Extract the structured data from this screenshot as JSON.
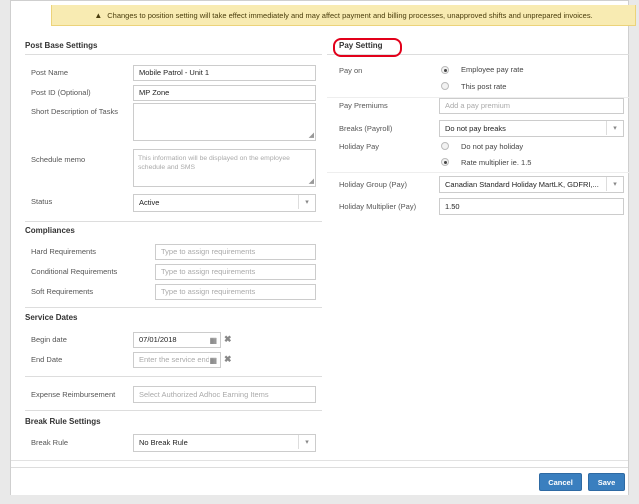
{
  "warning": {
    "icon": "warning-triangle-icon",
    "text": "Changes to position setting will take effect immediately and may affect payment and billing processes, unapproved shifts and unprepared invoices."
  },
  "post_base": {
    "title": "Post Base Settings",
    "post_name_label": "Post Name",
    "post_name_value": "Mobile Patrol - Unit 1",
    "post_id_label": "Post ID (Optional)",
    "post_id_value": "MP Zone",
    "short_desc_label": "Short Description of Tasks",
    "short_desc_value": "",
    "schedule_memo_label": "Schedule memo",
    "schedule_memo_placeholder": "This information will be displayed on the employee schedule and SMS",
    "status_label": "Status",
    "status_value": "Active"
  },
  "compliances": {
    "title": "Compliances",
    "hard_label": "Hard Requirements",
    "hard_placeholder": "Type to assign requirements",
    "conditional_label": "Conditional Requirements",
    "conditional_placeholder": "Type to assign requirements",
    "soft_label": "Soft Requirements",
    "soft_placeholder": "Type to assign requirements"
  },
  "service_dates": {
    "title": "Service Dates",
    "begin_label": "Begin date",
    "begin_value": "07/01/2018",
    "end_label": "End Date",
    "end_placeholder": "Enter the service end"
  },
  "expense": {
    "label": "Expense Reimbursement",
    "placeholder": "Select Authorized Adhoc Earning Items"
  },
  "break_rule": {
    "title": "Break Rule Settings",
    "label": "Break Rule",
    "value": "No Break Rule"
  },
  "pay": {
    "title": "Pay Setting",
    "pay_on_label": "Pay on",
    "pay_on_options": [
      "Employee pay rate",
      "This post rate"
    ],
    "pay_on_selected": 0,
    "premiums_label": "Pay Premiums",
    "premiums_placeholder": "Add a pay premium",
    "breaks_label": "Breaks (Payroll)",
    "breaks_value": "Do not pay breaks",
    "holiday_pay_label": "Holiday Pay",
    "holiday_options": [
      "Do not pay holiday",
      "Rate multiplier ie. 1.5"
    ],
    "holiday_selected": 1,
    "holiday_group_label": "Holiday Group (Pay)",
    "holiday_group_value": "Canadian Standard Holiday MartLK, GDFRI,...",
    "holiday_multiplier_label": "Holiday Multiplier (Pay)",
    "holiday_multiplier_value": "1.50"
  },
  "footer": {
    "cancel_label": "Cancel",
    "save_label": "Save"
  },
  "colors": {
    "primary": "#3a7fbf",
    "warning_bg": "#f8ebb2",
    "highlight": "#e2001a"
  }
}
